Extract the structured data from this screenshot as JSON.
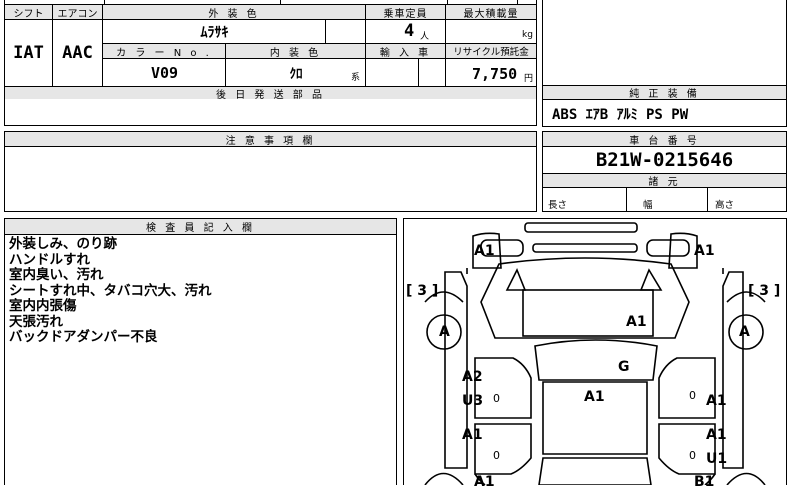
{
  "header": {
    "shift_label": "シフト",
    "aircon_label": "エアコン",
    "ext_color_label": "外 装 色",
    "capacity_label": "乗車定員",
    "max_load_label": "最大積載量",
    "color_no_label": "カ ラ ー N o .",
    "int_color_label": "内 装 色",
    "import_label": "輸 入 車",
    "recycle_label": "リサイクル預託金"
  },
  "vehicle": {
    "shift": "IAT",
    "aircon": "AAC",
    "ext_color": "ﾑﾗｻｷ",
    "capacity": "4",
    "capacity_unit": "人",
    "max_load_unit": "kg",
    "color_no": "V09",
    "int_color": "ｸﾛ",
    "int_color_suffix": "系",
    "recycle_fee": "7,750",
    "recycle_unit": "円"
  },
  "parts_later": {
    "label": "後 日 発 送 部 品"
  },
  "equipment": {
    "label": "純 正 装 備",
    "value": "ABS ｴｱB ｱﾙﾐ PS PW"
  },
  "notes": {
    "label": "注 意 事 項 欄"
  },
  "chassis": {
    "label": "車 台 番 号",
    "value": "B21W-0215646"
  },
  "specs": {
    "label": "諸 元",
    "length": "長さ",
    "width": "幅",
    "height": "高さ"
  },
  "inspector": {
    "label": "検 査 員 記 入 欄",
    "remarks": [
      "外装しみ、のり跡",
      "ハンドルすれ",
      "室内臭い、汚れ",
      "シートすれ中、タバコ穴大、汚れ",
      "室内内張傷",
      "天張汚れ",
      "バックドアダンパー不良"
    ]
  },
  "diagram": {
    "bracket_left": "[ 3 ]",
    "bracket_right": "[ 3 ]",
    "marks": {
      "front_left": "A1",
      "front_right": "A1",
      "wheel_left": "A",
      "wheel_right": "A",
      "hood": "A1",
      "windshield": "G",
      "roof": "A1",
      "door_fl_1": "A2",
      "door_fl_2": "U3",
      "door_fr": "A1",
      "door_rl": "A1",
      "door_rr_1": "A1",
      "door_rr_2": "U1",
      "rear_left": "A1",
      "rear_right": "B1",
      "zero": "0"
    }
  }
}
